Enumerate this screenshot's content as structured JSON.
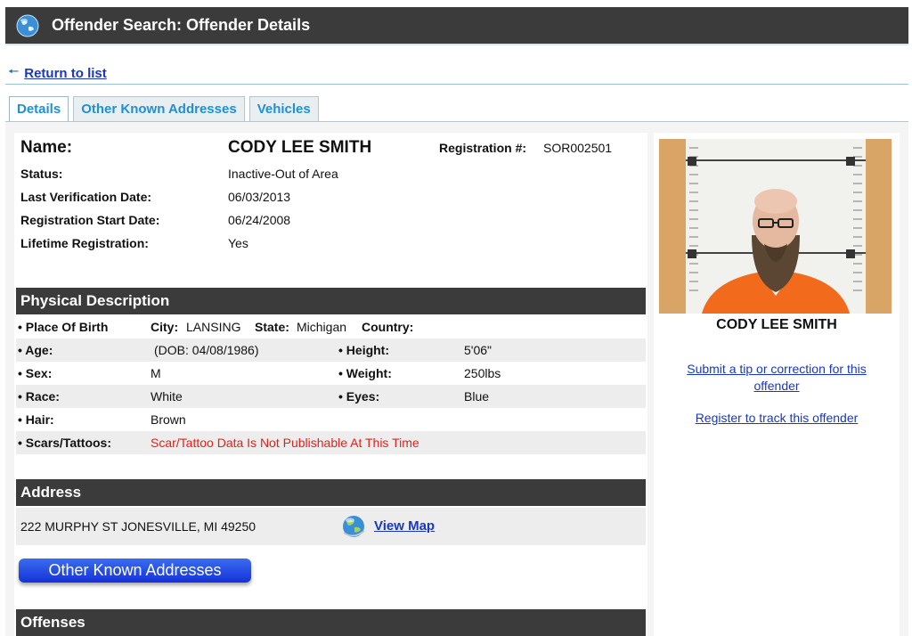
{
  "header": {
    "title": "Offender Search: Offender Details",
    "icon": "globe-icon"
  },
  "nav": {
    "return_label": "Return to list"
  },
  "tabs": [
    {
      "label": "Details",
      "active": true
    },
    {
      "label": "Other Known Addresses",
      "active": false
    },
    {
      "label": "Vehicles",
      "active": false
    }
  ],
  "offender": {
    "name_label": "Name:",
    "name": "CODY LEE SMITH",
    "registration_label": "Registration #:",
    "registration": "SOR002501",
    "status_label": "Status:",
    "status": "Inactive-Out of Area",
    "last_verification_label": "Last Verification Date:",
    "last_verification": "06/03/2013",
    "registration_start_label": "Registration Start Date:",
    "registration_start": "06/24/2008",
    "lifetime_label": "Lifetime Registration:",
    "lifetime": "Yes"
  },
  "physical": {
    "title": "Physical Description",
    "place_of_birth_label": "• Place Of Birth",
    "city_label": "City:",
    "city": "LANSING",
    "state_label": "State:",
    "state": "Michigan",
    "country_label": "Country:",
    "country": "",
    "age_label": "• Age:",
    "age": "(DOB: 04/08/1986)",
    "height_label": "• Height:",
    "height": "5'06\"",
    "sex_label": "• Sex:",
    "sex": "M",
    "weight_label": "• Weight:",
    "weight": "250lbs",
    "race_label": "• Race:",
    "race": "White",
    "eyes_label": "• Eyes:",
    "eyes": "Blue",
    "hair_label": "• Hair:",
    "hair": "Brown",
    "scars_label": "• Scars/Tattoos:",
    "scars": "Scar/Tattoo Data Is Not Publishable At This Time"
  },
  "address": {
    "title": "Address",
    "value": "222 MURPHY ST JONESVILLE, MI 49250",
    "view_map_label": "View Map",
    "other_addresses_button": "Other Known Addresses"
  },
  "offenses": {
    "title": "Offenses"
  },
  "sidebar": {
    "photo_name": "CODY LEE SMITH",
    "tip_link": "Submit a tip or correction for this offender",
    "track_link": "Register to track this offender"
  },
  "colors": {
    "header_bg": "#3b3b3b",
    "tab_text": "#1f8fd6",
    "link": "#1a37c4",
    "warning_text": "#e0221b",
    "button_blue": "#1f3fe0"
  }
}
